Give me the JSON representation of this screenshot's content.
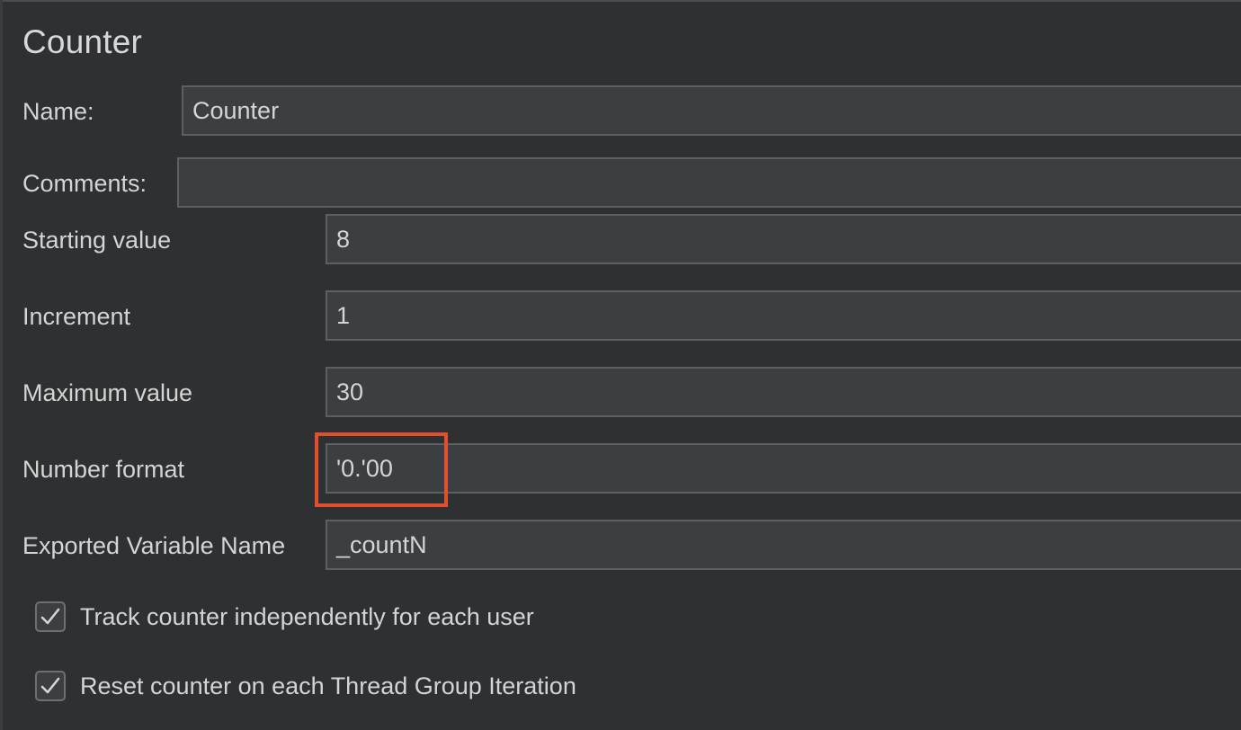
{
  "panel": {
    "title": "Counter"
  },
  "fields": {
    "name": {
      "label": "Name:",
      "value": "Counter"
    },
    "comments": {
      "label": "Comments:",
      "value": ""
    },
    "starting_value": {
      "label": "Starting value",
      "value": "8"
    },
    "increment": {
      "label": "Increment",
      "value": "1"
    },
    "maximum_value": {
      "label": "Maximum value",
      "value": "30"
    },
    "number_format": {
      "label": "Number format",
      "value": "'0.'00"
    },
    "exported_variable_name": {
      "label": "Exported Variable Name",
      "value": "_countN"
    }
  },
  "checkboxes": {
    "track_independently": {
      "label": "Track counter independently for each user",
      "checked": true,
      "icon": "checkmark-icon"
    },
    "reset_each_iteration": {
      "label": "Reset counter on each Thread Group Iteration",
      "checked": true,
      "icon": "checkmark-icon"
    }
  },
  "colors": {
    "background": "#2e3032",
    "field_background": "#3c3f41",
    "field_border": "#5d6063",
    "text": "#d4d4d4",
    "highlight": "#e0502f"
  }
}
